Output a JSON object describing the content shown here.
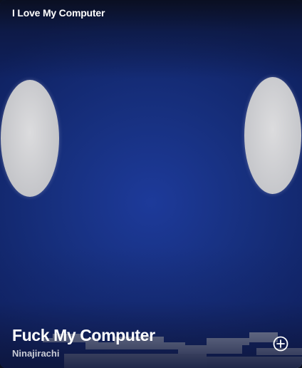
{
  "header": {
    "playlist_title": "I Love My Computer"
  },
  "track": {
    "title": "Fuck My Computer",
    "artist": "Ninajirachi"
  },
  "controls": {
    "add_icon": "plus-circle-icon"
  },
  "colors": {
    "background_blue": "#17307f",
    "eye_grey": "#c4c5c9",
    "text_primary": "#ffffff",
    "text_secondary": "#c9ccd6"
  }
}
